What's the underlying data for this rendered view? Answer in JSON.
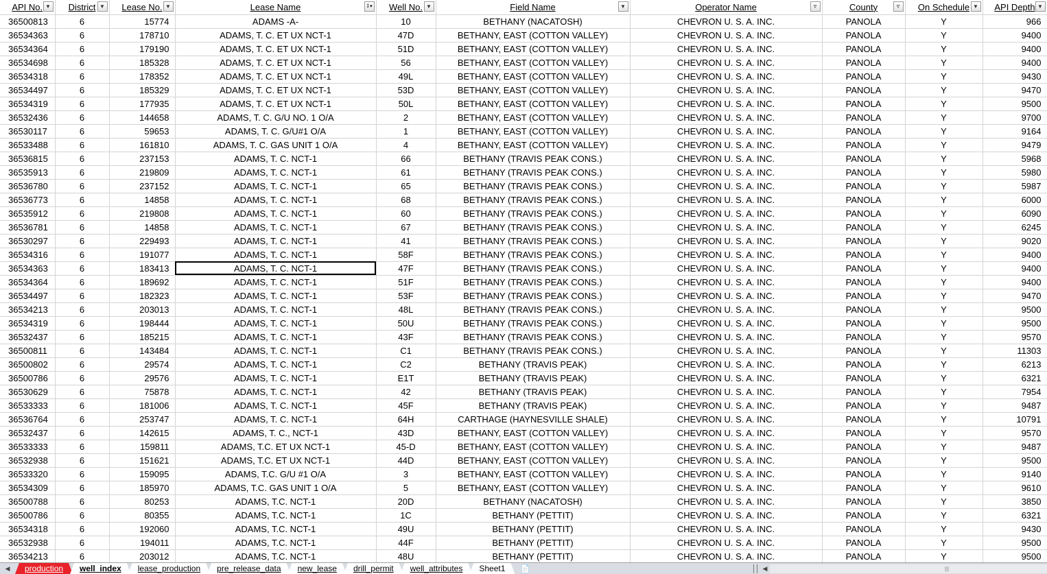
{
  "columns": [
    {
      "label": "API No.",
      "filter": "normal"
    },
    {
      "label": "District",
      "filter": "normal"
    },
    {
      "label": "Lease No.",
      "filter": "normal"
    },
    {
      "label": "Lease Name",
      "filter": "sorted"
    },
    {
      "label": "Well No.",
      "filter": "normal"
    },
    {
      "label": "Field Name",
      "filter": "normal"
    },
    {
      "label": "Operator Name",
      "filter": "filtered"
    },
    {
      "label": "County",
      "filter": "filtered"
    },
    {
      "label": "On Schedule",
      "filter": "normal"
    },
    {
      "label": "API Depth",
      "filter": "normal"
    }
  ],
  "rows": [
    [
      "36500813",
      "6",
      "15774",
      "ADAMS -A-",
      "10",
      "BETHANY (NACATOSH)",
      "CHEVRON U. S. A. INC.",
      "PANOLA",
      "Y",
      "966"
    ],
    [
      "36534363",
      "6",
      "178710",
      "ADAMS, T. C. ET UX NCT-1",
      "47D",
      "BETHANY, EAST (COTTON VALLEY)",
      "CHEVRON U. S. A. INC.",
      "PANOLA",
      "Y",
      "9400"
    ],
    [
      "36534364",
      "6",
      "179190",
      "ADAMS, T. C. ET UX NCT-1",
      "51D",
      "BETHANY, EAST (COTTON VALLEY)",
      "CHEVRON U. S. A. INC.",
      "PANOLA",
      "Y",
      "9400"
    ],
    [
      "36534698",
      "6",
      "185328",
      "ADAMS, T. C. ET UX NCT-1",
      "56",
      "BETHANY, EAST (COTTON VALLEY)",
      "CHEVRON U. S. A. INC.",
      "PANOLA",
      "Y",
      "9400"
    ],
    [
      "36534318",
      "6",
      "178352",
      "ADAMS, T. C. ET UX NCT-1",
      "49L",
      "BETHANY, EAST (COTTON VALLEY)",
      "CHEVRON U. S. A. INC.",
      "PANOLA",
      "Y",
      "9430"
    ],
    [
      "36534497",
      "6",
      "185329",
      "ADAMS, T. C. ET UX NCT-1",
      "53D",
      "BETHANY, EAST (COTTON VALLEY)",
      "CHEVRON U. S. A. INC.",
      "PANOLA",
      "Y",
      "9470"
    ],
    [
      "36534319",
      "6",
      "177935",
      "ADAMS, T. C. ET UX NCT-1",
      "50L",
      "BETHANY, EAST (COTTON VALLEY)",
      "CHEVRON U. S. A. INC.",
      "PANOLA",
      "Y",
      "9500"
    ],
    [
      "36532436",
      "6",
      "144658",
      "ADAMS, T. C. G/U NO. 1 O/A",
      "2",
      "BETHANY, EAST (COTTON VALLEY)",
      "CHEVRON U. S. A. INC.",
      "PANOLA",
      "Y",
      "9700"
    ],
    [
      "36530117",
      "6",
      "59653",
      "ADAMS, T. C. G/U#1 O/A",
      "1",
      "BETHANY, EAST (COTTON VALLEY)",
      "CHEVRON U. S. A. INC.",
      "PANOLA",
      "Y",
      "9164"
    ],
    [
      "36533488",
      "6",
      "161810",
      "ADAMS, T. C. GAS UNIT 1 O/A",
      "4",
      "BETHANY, EAST (COTTON VALLEY)",
      "CHEVRON U. S. A. INC.",
      "PANOLA",
      "Y",
      "9479"
    ],
    [
      "36536815",
      "6",
      "237153",
      "ADAMS, T. C. NCT-1",
      "66",
      "BETHANY (TRAVIS PEAK CONS.)",
      "CHEVRON U. S. A. INC.",
      "PANOLA",
      "Y",
      "5968"
    ],
    [
      "36535913",
      "6",
      "219809",
      "ADAMS, T. C. NCT-1",
      "61",
      "BETHANY (TRAVIS PEAK CONS.)",
      "CHEVRON U. S. A. INC.",
      "PANOLA",
      "Y",
      "5980"
    ],
    [
      "36536780",
      "6",
      "237152",
      "ADAMS, T. C. NCT-1",
      "65",
      "BETHANY (TRAVIS PEAK CONS.)",
      "CHEVRON U. S. A. INC.",
      "PANOLA",
      "Y",
      "5987"
    ],
    [
      "36536773",
      "6",
      "14858",
      "ADAMS, T. C. NCT-1",
      "68",
      "BETHANY (TRAVIS PEAK CONS.)",
      "CHEVRON U. S. A. INC.",
      "PANOLA",
      "Y",
      "6000"
    ],
    [
      "36535912",
      "6",
      "219808",
      "ADAMS, T. C. NCT-1",
      "60",
      "BETHANY (TRAVIS PEAK CONS.)",
      "CHEVRON U. S. A. INC.",
      "PANOLA",
      "Y",
      "6090"
    ],
    [
      "36536781",
      "6",
      "14858",
      "ADAMS, T. C. NCT-1",
      "67",
      "BETHANY (TRAVIS PEAK CONS.)",
      "CHEVRON U. S. A. INC.",
      "PANOLA",
      "Y",
      "6245"
    ],
    [
      "36530297",
      "6",
      "229493",
      "ADAMS, T. C. NCT-1",
      "41",
      "BETHANY (TRAVIS PEAK CONS.)",
      "CHEVRON U. S. A. INC.",
      "PANOLA",
      "Y",
      "9020"
    ],
    [
      "36534316",
      "6",
      "191077",
      "ADAMS, T. C. NCT-1",
      "58F",
      "BETHANY (TRAVIS PEAK CONS.)",
      "CHEVRON U. S. A. INC.",
      "PANOLA",
      "Y",
      "9400"
    ],
    [
      "36534363",
      "6",
      "183413",
      "ADAMS, T. C. NCT-1",
      "47F",
      "BETHANY (TRAVIS PEAK CONS.)",
      "CHEVRON U. S. A. INC.",
      "PANOLA",
      "Y",
      "9400"
    ],
    [
      "36534364",
      "6",
      "189692",
      "ADAMS, T. C. NCT-1",
      "51F",
      "BETHANY (TRAVIS PEAK CONS.)",
      "CHEVRON U. S. A. INC.",
      "PANOLA",
      "Y",
      "9400"
    ],
    [
      "36534497",
      "6",
      "182323",
      "ADAMS, T. C. NCT-1",
      "53F",
      "BETHANY (TRAVIS PEAK CONS.)",
      "CHEVRON U. S. A. INC.",
      "PANOLA",
      "Y",
      "9470"
    ],
    [
      "36534213",
      "6",
      "203013",
      "ADAMS, T. C. NCT-1",
      "48L",
      "BETHANY (TRAVIS PEAK CONS.)",
      "CHEVRON U. S. A. INC.",
      "PANOLA",
      "Y",
      "9500"
    ],
    [
      "36534319",
      "6",
      "198444",
      "ADAMS, T. C. NCT-1",
      "50U",
      "BETHANY (TRAVIS PEAK CONS.)",
      "CHEVRON U. S. A. INC.",
      "PANOLA",
      "Y",
      "9500"
    ],
    [
      "36532437",
      "6",
      "185215",
      "ADAMS, T. C. NCT-1",
      "43F",
      "BETHANY (TRAVIS PEAK CONS.)",
      "CHEVRON U. S. A. INC.",
      "PANOLA",
      "Y",
      "9570"
    ],
    [
      "36500811",
      "6",
      "143484",
      "ADAMS, T. C. NCT-1",
      "C1",
      "BETHANY (TRAVIS PEAK CONS.)",
      "CHEVRON U. S. A. INC.",
      "PANOLA",
      "Y",
      "11303"
    ],
    [
      "36500802",
      "6",
      "29574",
      "ADAMS, T. C. NCT-1",
      "C2",
      "BETHANY (TRAVIS PEAK)",
      "CHEVRON U. S. A. INC.",
      "PANOLA",
      "Y",
      "6213"
    ],
    [
      "36500786",
      "6",
      "29576",
      "ADAMS, T. C. NCT-1",
      "E1T",
      "BETHANY (TRAVIS PEAK)",
      "CHEVRON U. S. A. INC.",
      "PANOLA",
      "Y",
      "6321"
    ],
    [
      "36530629",
      "6",
      "75878",
      "ADAMS, T. C. NCT-1",
      "42",
      "BETHANY (TRAVIS PEAK)",
      "CHEVRON U. S. A. INC.",
      "PANOLA",
      "Y",
      "7954"
    ],
    [
      "36533333",
      "6",
      "181006",
      "ADAMS, T. C. NCT-1",
      "45F",
      "BETHANY (TRAVIS PEAK)",
      "CHEVRON U. S. A. INC.",
      "PANOLA",
      "Y",
      "9487"
    ],
    [
      "36536764",
      "6",
      "253747",
      "ADAMS, T. C. NCT-1",
      "64H",
      "CARTHAGE (HAYNESVILLE SHALE)",
      "CHEVRON U. S. A. INC.",
      "PANOLA",
      "Y",
      "10791"
    ],
    [
      "36532437",
      "6",
      "142615",
      "ADAMS, T. C., NCT-1",
      "43D",
      "BETHANY, EAST (COTTON VALLEY)",
      "CHEVRON U. S. A. INC.",
      "PANOLA",
      "Y",
      "9570"
    ],
    [
      "36533333",
      "6",
      "159811",
      "ADAMS, T.C. ET UX NCT-1",
      "45-D",
      "BETHANY, EAST (COTTON VALLEY)",
      "CHEVRON U. S. A. INC.",
      "PANOLA",
      "Y",
      "9487"
    ],
    [
      "36532938",
      "6",
      "151621",
      "ADAMS, T.C. ET UX NCT-1",
      "44D",
      "BETHANY, EAST (COTTON VALLEY)",
      "CHEVRON U. S. A. INC.",
      "PANOLA",
      "Y",
      "9500"
    ],
    [
      "36533320",
      "6",
      "159095",
      "ADAMS, T.C. G/U #1 O/A",
      "3",
      "BETHANY, EAST (COTTON VALLEY)",
      "CHEVRON U. S. A. INC.",
      "PANOLA",
      "Y",
      "9140"
    ],
    [
      "36534309",
      "6",
      "185970",
      "ADAMS, T.C. GAS UNIT 1 O/A",
      "5",
      "BETHANY, EAST (COTTON VALLEY)",
      "CHEVRON U. S. A. INC.",
      "PANOLA",
      "Y",
      "9610"
    ],
    [
      "36500788",
      "6",
      "80253",
      "ADAMS, T.C. NCT-1",
      "20D",
      "BETHANY (NACATOSH)",
      "CHEVRON U. S. A. INC.",
      "PANOLA",
      "Y",
      "3850"
    ],
    [
      "36500786",
      "6",
      "80355",
      "ADAMS, T.C. NCT-1",
      "1C",
      "BETHANY (PETTIT)",
      "CHEVRON U. S. A. INC.",
      "PANOLA",
      "Y",
      "6321"
    ],
    [
      "36534318",
      "6",
      "192060",
      "ADAMS, T.C. NCT-1",
      "49U",
      "BETHANY (PETTIT)",
      "CHEVRON U. S. A. INC.",
      "PANOLA",
      "Y",
      "9430"
    ],
    [
      "36532938",
      "6",
      "194011",
      "ADAMS, T.C. NCT-1",
      "44F",
      "BETHANY (PETTIT)",
      "CHEVRON U. S. A. INC.",
      "PANOLA",
      "Y",
      "9500"
    ],
    [
      "36534213",
      "6",
      "203012",
      "ADAMS, T.C. NCT-1",
      "48U",
      "BETHANY (PETTIT)",
      "CHEVRON U. S. A. INC.",
      "PANOLA",
      "Y",
      "9500"
    ]
  ],
  "selected_cell": {
    "row": 18,
    "col": 3
  },
  "tabs": [
    {
      "label": "production",
      "style": "red"
    },
    {
      "label": "well_index",
      "style": "active"
    },
    {
      "label": "lease_production",
      "style": "normal"
    },
    {
      "label": "pre_release_data",
      "style": "normal"
    },
    {
      "label": "new_lease",
      "style": "normal"
    },
    {
      "label": "drill_permit",
      "style": "normal"
    },
    {
      "label": "well_attributes",
      "style": "normal"
    },
    {
      "label": "Sheet1",
      "style": "plain"
    }
  ],
  "colors": {
    "tab_red": "#e8232a",
    "grid": "#d4d4d4",
    "tabbar": "#d9dde3"
  }
}
